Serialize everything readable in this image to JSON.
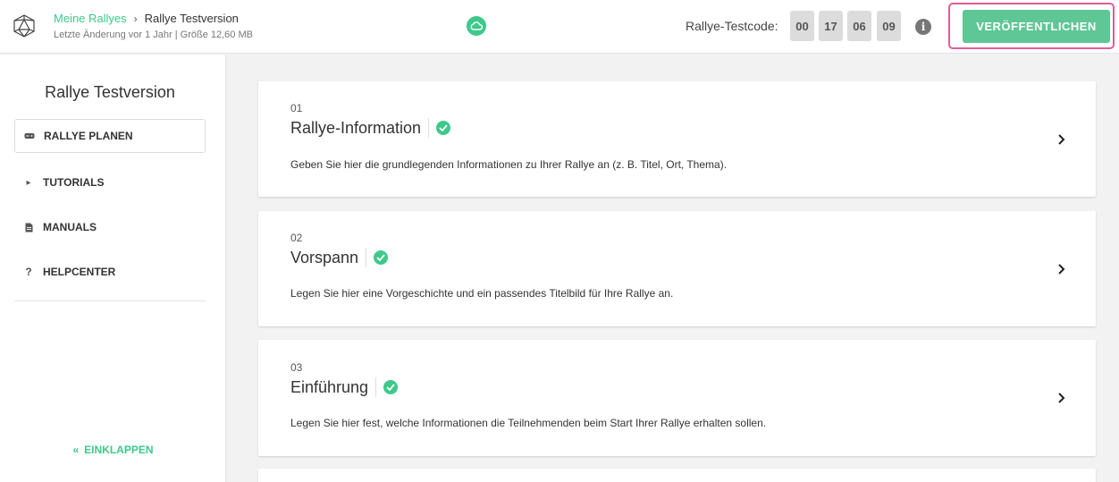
{
  "header": {
    "breadcrumb_link": "Meine Rallyes",
    "breadcrumb_current": "Rallye Testversion",
    "meta": "Letzte Änderung vor 1 Jahr | Größe 12,60 MB",
    "code_label": "Rallye-Testcode:",
    "code": [
      "00",
      "17",
      "06",
      "09"
    ],
    "info": "i",
    "publish_label": "VERÖFFENTLICHEN"
  },
  "sidebar": {
    "title": "Rallye Testversion",
    "items": [
      {
        "label": "RALLYE PLANEN",
        "icon": "gamepad-icon"
      },
      {
        "label": "TUTORIALS",
        "icon": "play-icon"
      },
      {
        "label": "MANUALS",
        "icon": "document-icon"
      },
      {
        "label": "HELPCENTER",
        "icon": "question-icon"
      }
    ],
    "collapse_label": "EINKLAPPEN"
  },
  "cards": [
    {
      "num": "01",
      "title": "Rallye-Information",
      "desc": "Geben Sie hier die grundlegenden Informationen zu Ihrer Rallye an (z. B. Titel, Ort, Thema)."
    },
    {
      "num": "02",
      "title": "Vorspann",
      "desc": "Legen Sie hier eine Vorgeschichte und ein passendes Titelbild für Ihre Rallye an."
    },
    {
      "num": "03",
      "title": "Einführung",
      "desc": "Legen Sie hier fest, welche Informationen die Teilnehmenden beim Start Ihrer Rallye erhalten sollen."
    }
  ],
  "colors": {
    "accent": "#3ec98a",
    "publish": "#5ec795",
    "highlight": "#e55b95"
  }
}
